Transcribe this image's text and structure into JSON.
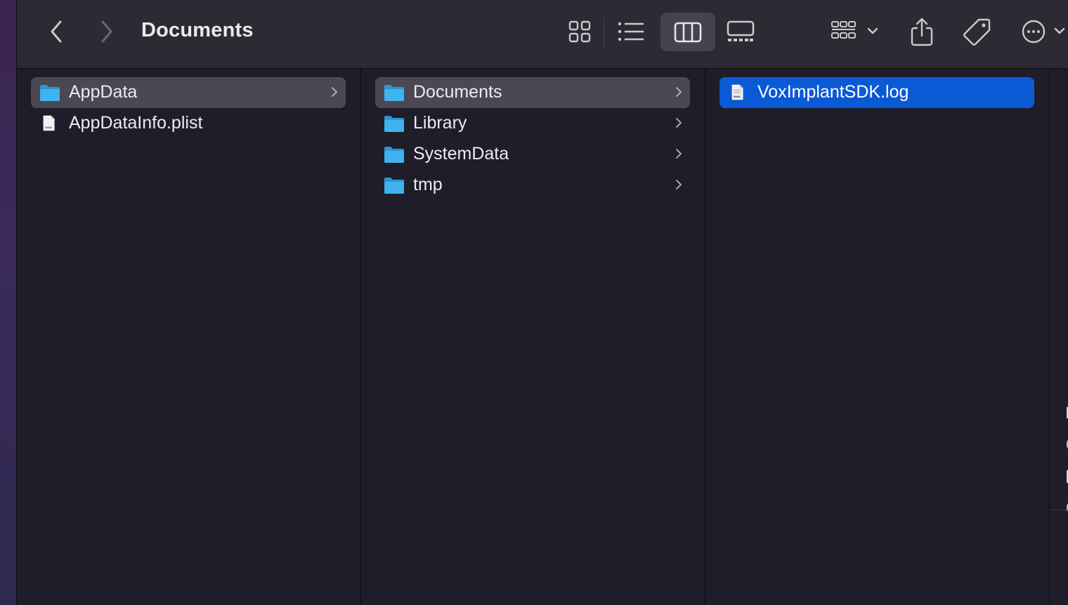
{
  "window": {
    "title": "Documents"
  },
  "toolbar": {
    "back_icon": "chevron-left-icon",
    "forward_icon": "chevron-right-icon",
    "views": [
      {
        "name": "icon-view",
        "icon": "grid-icon",
        "selected": false
      },
      {
        "name": "list-view",
        "icon": "list-icon",
        "selected": false
      },
      {
        "name": "column-view",
        "icon": "columns-icon",
        "selected": true
      },
      {
        "name": "gallery-view",
        "icon": "gallery-icon",
        "selected": false
      }
    ],
    "group_icon": "group-icon",
    "share_icon": "share-icon",
    "tag_icon": "tag-icon",
    "more_icon": "more-icon"
  },
  "columns": [
    {
      "items": [
        {
          "label": "AppData",
          "kind": "folder",
          "selected": "gray",
          "has_children": true
        },
        {
          "label": "AppDataInfo.plist",
          "kind": "plist-file",
          "selected": "none",
          "has_children": false
        }
      ]
    },
    {
      "items": [
        {
          "label": "Documents",
          "kind": "folder",
          "selected": "gray",
          "has_children": true
        },
        {
          "label": "Library",
          "kind": "folder",
          "selected": "none",
          "has_children": true
        },
        {
          "label": "SystemData",
          "kind": "folder",
          "selected": "none",
          "has_children": true
        },
        {
          "label": "tmp",
          "kind": "folder",
          "selected": "none",
          "has_children": true
        }
      ]
    },
    {
      "items": [
        {
          "label": "VoxImplantSDK.log",
          "kind": "log-file",
          "selected": "blue",
          "has_children": false
        }
      ]
    }
  ],
  "colors": {
    "selection_blue": "#0a5ad6",
    "selection_gray": "#4a4953",
    "folder_blue": "#3fb1ec",
    "window_bg": "#1f1d29",
    "toolbar_bg": "#2c2b34"
  }
}
